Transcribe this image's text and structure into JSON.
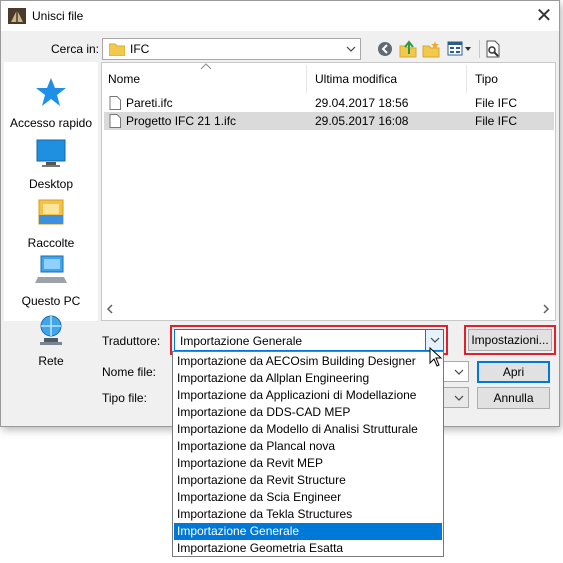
{
  "window": {
    "title": "Unisci file",
    "close_glyph": "✕"
  },
  "toolbar": {
    "look_in_label": "Cerca in:",
    "look_in_value": "IFC",
    "icons": [
      "back-icon",
      "up-folder-icon",
      "new-folder-icon",
      "view-menu-icon",
      "preview-icon"
    ]
  },
  "places": [
    {
      "label": "Accesso rapido",
      "icon": "star-icon"
    },
    {
      "label": "Desktop",
      "icon": "desktop-icon"
    },
    {
      "label": "Raccolte",
      "icon": "libraries-icon"
    },
    {
      "label": "Questo PC",
      "icon": "computer-icon"
    },
    {
      "label": "Rete",
      "icon": "network-icon"
    }
  ],
  "file_list": {
    "columns": [
      "Nome",
      "Ultima modifica",
      "Tipo"
    ],
    "rows": [
      {
        "name": "Pareti.ifc",
        "modified": "29.04.2017 18:56",
        "type": "File IFC",
        "selected": false
      },
      {
        "name": "Progetto IFC 21 1.ifc",
        "modified": "29.05.2017 16:08",
        "type": "File IFC",
        "selected": true
      }
    ]
  },
  "form": {
    "translator_label": "Traduttore:",
    "translator_value": "Importazione Generale",
    "filename_label": "Nome file:",
    "filetype_label": "Tipo file:"
  },
  "buttons": {
    "settings": "Impostazioni...",
    "open": "Apri",
    "cancel": "Annulla"
  },
  "dropdown": {
    "options": [
      "Importazione da AECOsim Building Designer",
      "Importazione da Allplan Engineering",
      "Importazione da Applicazioni di Modellazione",
      "Importazione da DDS-CAD MEP",
      "Importazione da Modello di Analisi Strutturale",
      "Importazione da Plancal nova",
      "Importazione da Revit MEP",
      "Importazione da Revit Structure",
      "Importazione da Scia Engineer",
      "Importazione da Tekla Structures",
      "Importazione Generale",
      "Importazione Geometria Esatta"
    ],
    "selected": "Importazione Generale"
  },
  "colors": {
    "accent": "#0078d7",
    "highlight": "#e0202a",
    "selection": "#dadada"
  }
}
